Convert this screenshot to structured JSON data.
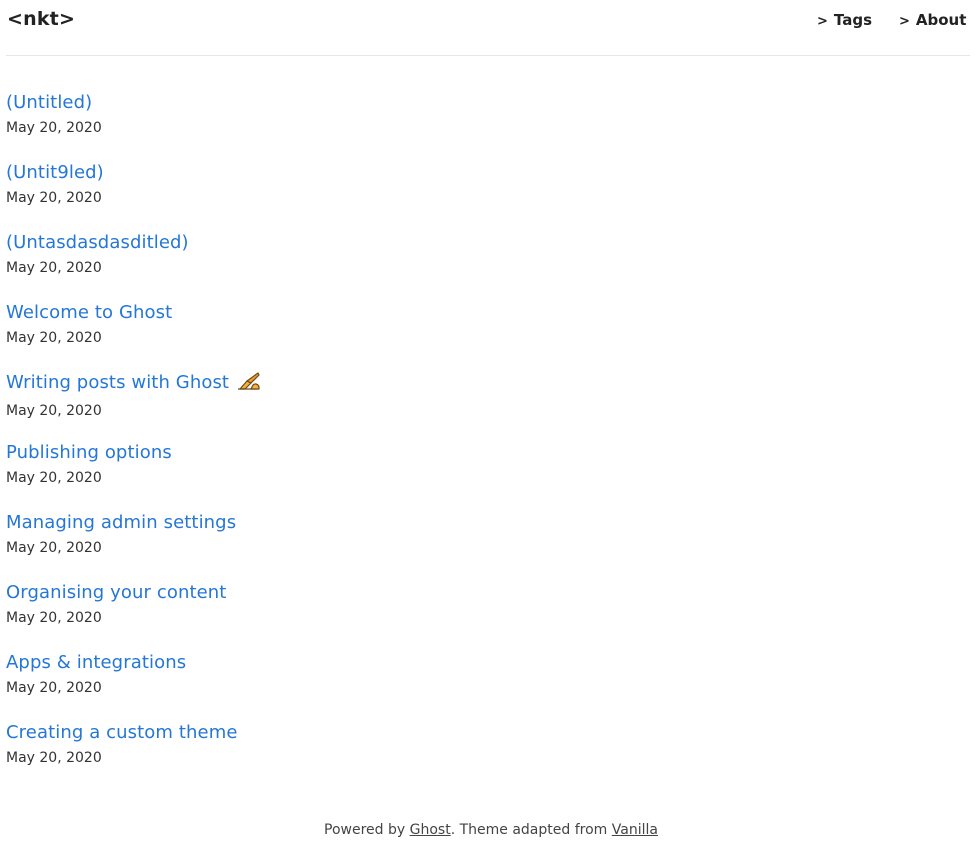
{
  "header": {
    "logo": "<nkt>",
    "nav": [
      {
        "arrow": ">",
        "label": "Tags"
      },
      {
        "arrow": ">",
        "label": "About"
      }
    ]
  },
  "posts": [
    {
      "title": "(Untitled)",
      "date": "May 20, 2020"
    },
    {
      "title": "(Untit9led)",
      "date": "May 20, 2020"
    },
    {
      "title": "(Untasdasdasditled)",
      "date": "May 20, 2020"
    },
    {
      "title": "Welcome to Ghost",
      "date": "May 20, 2020"
    },
    {
      "title": "Writing posts with Ghost",
      "date": "May 20, 2020",
      "icon": "writing-hand-icon"
    },
    {
      "title": "Publishing options",
      "date": "May 20, 2020"
    },
    {
      "title": "Managing admin settings",
      "date": "May 20, 2020"
    },
    {
      "title": "Organising your content",
      "date": "May 20, 2020"
    },
    {
      "title": "Apps & integrations",
      "date": "May 20, 2020"
    },
    {
      "title": "Creating a custom theme",
      "date": "May 20, 2020"
    }
  ],
  "footer": {
    "prefix": "Powered by ",
    "ghost_link": "Ghost",
    "middle": ". Theme adapted from ",
    "vanilla_link": "Vanilla"
  },
  "colors": {
    "link": "#2477d6",
    "text": "#222222"
  }
}
